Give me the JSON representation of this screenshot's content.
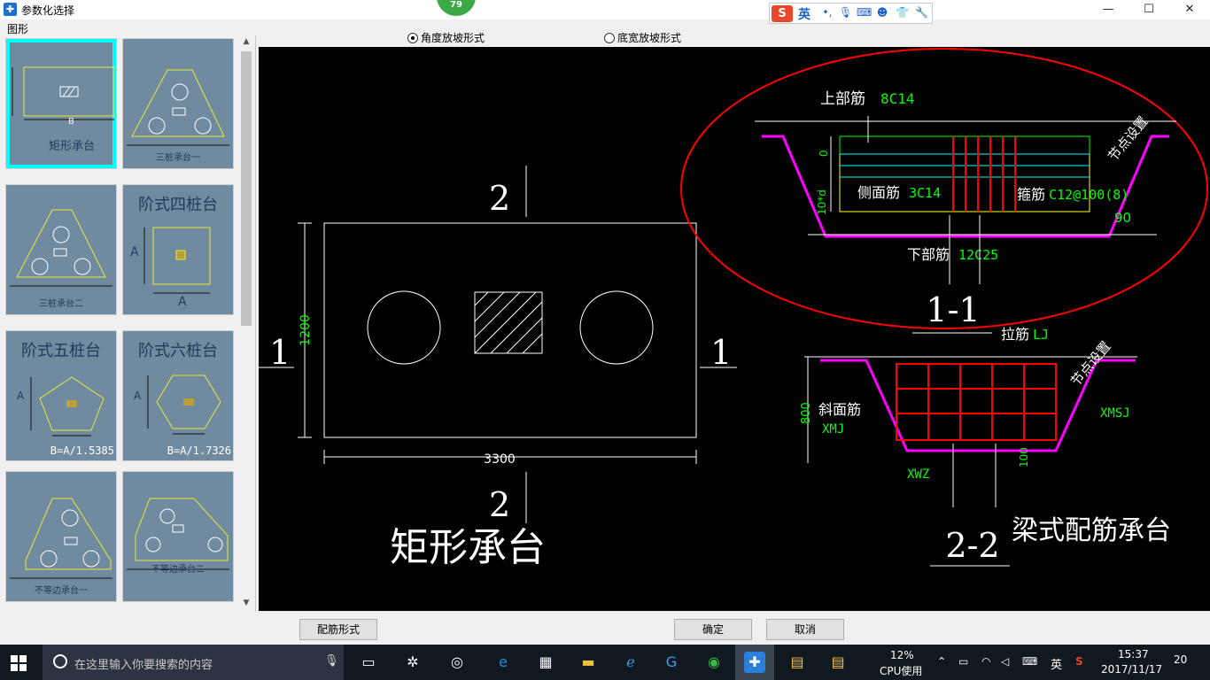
{
  "window": {
    "title": "参数化选择",
    "badge": "79",
    "minimize": "—",
    "maximize": "☐",
    "close": "✕"
  },
  "ime": {
    "logo": "S",
    "lang": "英"
  },
  "left": {
    "header": "图形",
    "thumbnails": [
      {
        "caption": "矩形承台",
        "dim": "B"
      },
      {
        "caption": "三桩承台一"
      },
      {
        "caption": "三桩承台二"
      },
      {
        "title": "阶式四桩台",
        "dim": "A"
      },
      {
        "title": "阶式五桩台",
        "formula": "B=A/1.5385",
        "dim": "A"
      },
      {
        "title": "阶式六桩台",
        "formula": "B=A/1.7326",
        "dim": "A"
      },
      {
        "caption": "不等边承台一"
      },
      {
        "caption": "不等边承台二"
      }
    ]
  },
  "radios": [
    {
      "label": "角度放坡形式",
      "checked": true
    },
    {
      "label": "底宽放坡形式",
      "checked": false
    }
  ],
  "drawing": {
    "main_title": "矩形承台",
    "dim_width": "3300",
    "dim_height": "1200",
    "section_1": "1",
    "section_2": "2",
    "sec11": {
      "label": "1-1",
      "top_bar": "上部筋",
      "top_bar_value": "8C14",
      "side_bar": "侧面筋",
      "side_bar_value": "3C14",
      "stirrup": "箍筋",
      "stirrup_value": "C12@100(8)",
      "bottom_bar": "下部筋",
      "bottom_bar_value": "12C25",
      "node": "节点设置",
      "angle": "90",
      "depth": "10*d",
      "zero": "0"
    },
    "sec22": {
      "label": "2-2",
      "tie": "拉筋",
      "tie_value": "LJ",
      "node": "节点设置",
      "slope": "斜面筋",
      "slope_value": "XMJ",
      "xmsj": "XMSJ",
      "xwz": "XWZ",
      "h800": "800",
      "h100": "100"
    },
    "beam_title": "梁式配筋承台"
  },
  "buttons": {
    "reinforce": "配筋形式",
    "ok": "确定",
    "cancel": "取消"
  },
  "taskbar": {
    "search_placeholder": "在这里输入你要搜索的内容",
    "cpu_pct": "12%",
    "cpu_label": "CPU使用",
    "lang": "英",
    "time": "15:37",
    "date": "2017/11/17",
    "notifications": "20"
  },
  "colors": {
    "canvas": "#000000",
    "green_text": "#00ff00",
    "red_annot": "#ff0000",
    "thumb_bg": "#708ba0",
    "selected": "#00ffff"
  }
}
